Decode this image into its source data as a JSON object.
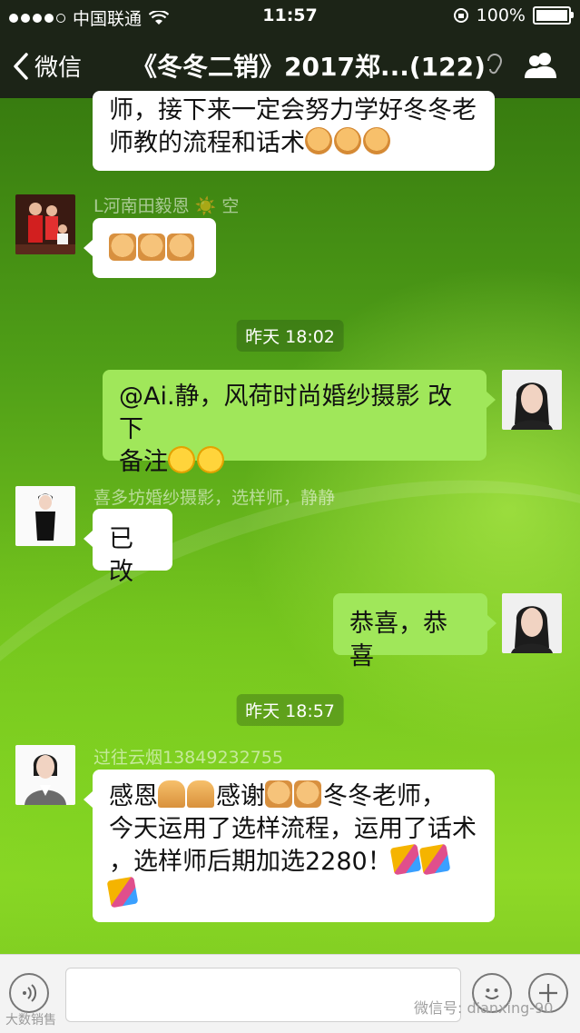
{
  "status_bar": {
    "carrier": "中国联通",
    "time": "11:57",
    "battery": "100%"
  },
  "nav": {
    "back_label": "微信",
    "title": "《冬冬二销》2017郑...(122)"
  },
  "messages": {
    "m0": {
      "line1": "师，接下来一定会努力学好冬冬老",
      "line2": "师教的流程和话术"
    },
    "m1": {
      "sender": "L河南田毅恩 ☀️ 空"
    },
    "ts1": "昨天 18:02",
    "m2": {
      "line1": "@Ai.静，风荷时尚婚纱摄影 改下",
      "line2": "备注"
    },
    "m3": {
      "sender": "喜多坊婚纱摄影，选样师，静静",
      "text": "已改"
    },
    "m4": {
      "text": "恭喜，恭喜"
    },
    "ts2": "昨天 18:57",
    "m5": {
      "sender": "过往云烟13849232755",
      "l1a": "感恩",
      "l1b": "感谢",
      "l1c": "冬冬老师，",
      "line2": "今天运用了选样流程，运用了话术",
      "line3": "，选样师后期加选2280！"
    }
  },
  "input": {
    "placeholder": ""
  },
  "watermarks": {
    "left": "大数销售",
    "right": "微信号: dianxing-90"
  },
  "colors": {
    "outgoing_bubble": "#a0e75a",
    "incoming_bubble": "#ffffff",
    "nav_bg": "#1c2417"
  }
}
